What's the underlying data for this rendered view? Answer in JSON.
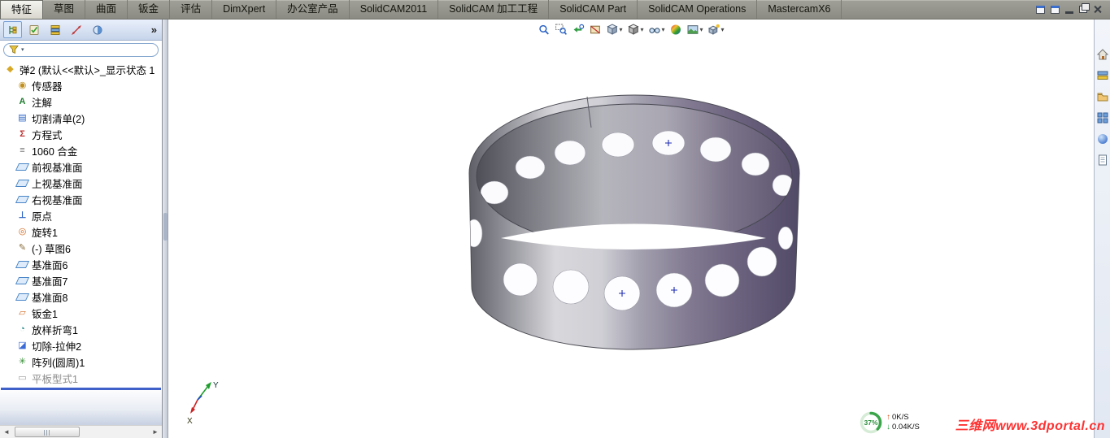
{
  "tab_bar": {
    "tabs": [
      {
        "label": "特征",
        "active": true
      },
      {
        "label": "草图"
      },
      {
        "label": "曲面"
      },
      {
        "label": "钣金"
      },
      {
        "label": "评估"
      },
      {
        "label": "DimXpert"
      },
      {
        "label": "办公室产品"
      },
      {
        "label": "SolidCAM2011"
      },
      {
        "label": "SolidCAM 加工工程"
      },
      {
        "label": "SolidCAM Part"
      },
      {
        "label": "SolidCAM Operations"
      },
      {
        "label": "MastercamX6"
      }
    ],
    "window_controls": [
      "document-icon",
      "document-icon",
      "minimize-icon",
      "restore-icon",
      "close-icon"
    ]
  },
  "left_panel": {
    "manager_tabs": [
      "featuremanager-icon",
      "propertymanager-icon",
      "configurationmanager-icon",
      "dimxpertmanager-icon",
      "displaymanager-icon"
    ],
    "more_chevron": "»",
    "filter": {
      "icon": "filter-funnel-icon"
    },
    "tree_root": "弹2 (默认<<默认>_显示状态 1",
    "items": [
      {
        "label": "传感器",
        "icon": "sensors-icon"
      },
      {
        "label": "注解",
        "icon": "annotations-icon"
      },
      {
        "label": "切割清单(2)",
        "icon": "cut-list-icon"
      },
      {
        "label": "方程式",
        "icon": "equations-icon"
      },
      {
        "label": "1060 合金",
        "icon": "material-icon"
      },
      {
        "label": "前视基准面",
        "icon": "plane-icon"
      },
      {
        "label": "上视基准面",
        "icon": "plane-icon"
      },
      {
        "label": "右视基准面",
        "icon": "plane-icon"
      },
      {
        "label": "原点",
        "icon": "origin-icon"
      },
      {
        "label": "旋转1",
        "icon": "revolve-icon"
      },
      {
        "label": "(-) 草图6",
        "icon": "sketch-icon"
      },
      {
        "label": "基准面6",
        "icon": "plane-icon"
      },
      {
        "label": "基准面7",
        "icon": "plane-icon"
      },
      {
        "label": "基准面8",
        "icon": "plane-icon"
      },
      {
        "label": "钣金1",
        "icon": "sheet-metal-icon"
      },
      {
        "label": "放样折弯1",
        "icon": "lofted-bend-icon"
      },
      {
        "label": "切除-拉伸2",
        "icon": "cut-extrude-icon"
      },
      {
        "label": "阵列(圆周)1",
        "icon": "circular-pattern-icon"
      },
      {
        "label": "平板型式1",
        "icon": "flat-pattern-icon",
        "grayed": true
      }
    ],
    "scrollbar": {
      "left": "◄",
      "right": "►"
    }
  },
  "viewport": {
    "toolbar": [
      {
        "name": "zoom-fit"
      },
      {
        "name": "zoom-area"
      },
      {
        "name": "previous-view"
      },
      {
        "name": "section-view"
      },
      {
        "name": "view-orientation",
        "dropdown": true
      },
      {
        "name": "display-style",
        "dropdown": true
      },
      {
        "name": "hide-show-items",
        "dropdown": true
      },
      {
        "name": "edit-appearance"
      },
      {
        "name": "apply-scene",
        "dropdown": true
      },
      {
        "name": "view-settings",
        "dropdown": true
      }
    ],
    "triad": {
      "x_label": "X",
      "y_label": "Y"
    },
    "overlay": {
      "progress": "37%",
      "upload_speed": "0K/S",
      "download_speed": "0.04K/S"
    },
    "watermark": "三维网www.3dportal.cn"
  },
  "task_pane": {
    "icons": [
      "home-icon",
      "design-library-icon",
      "file-explorer-icon",
      "view-palette-icon",
      "appearances-icon",
      "document-properties-icon"
    ]
  },
  "colors": {
    "accent_blue": "#2a62c4",
    "rollback_blue": "#3f5fc9",
    "watermark_red": "#ff3333",
    "progress_green": "#3aa54a",
    "viewport_bg": "#ffffff"
  }
}
